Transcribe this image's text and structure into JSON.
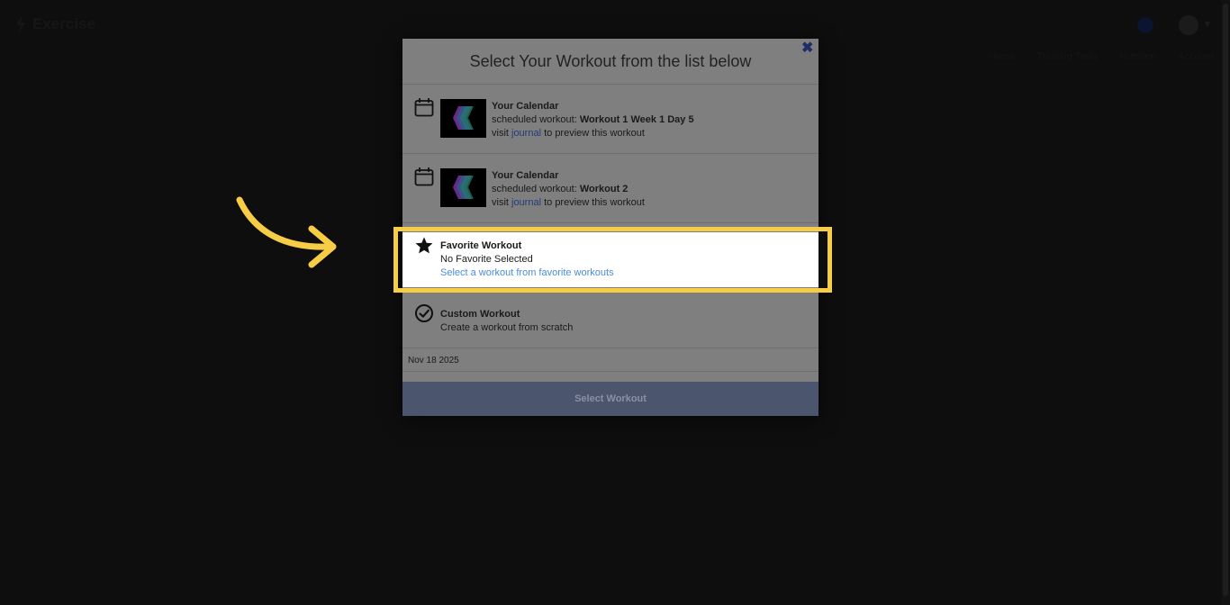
{
  "app": {
    "brand": "Exercise"
  },
  "background_nav": [
    "Home",
    "Training Tools",
    "Nutrition",
    "Account"
  ],
  "modal": {
    "title": "Select Your Workout from the list below",
    "close_symbol": "✖",
    "options": [
      {
        "title": "Your Calendar",
        "scheduled_prefix": "scheduled workout: ",
        "workout_name": "Workout 1 Week 1 Day 5",
        "visit_prefix": "visit ",
        "link_label": "journal",
        "visit_suffix": " to preview this workout",
        "icon": "calendar-icon"
      },
      {
        "title": "Your Calendar",
        "scheduled_prefix": "scheduled workout: ",
        "workout_name": "Workout 2",
        "visit_prefix": "visit ",
        "link_label": "journal",
        "visit_suffix": " to preview this workout",
        "icon": "calendar-icon"
      }
    ],
    "favorite": {
      "title": "Favorite Workout",
      "status": "No Favorite Selected",
      "link_label": "Select a workout from favorite workouts",
      "icon": "star-icon"
    },
    "custom": {
      "title": "Custom Workout",
      "subtitle": "Create a workout from scratch",
      "icon": "check-circle-icon"
    },
    "date": "Nov 18 2025",
    "select_button": "Select Workout"
  },
  "colors": {
    "highlight": "#f7cd46",
    "link": "#4a8cd8",
    "button": "#4c556e"
  }
}
